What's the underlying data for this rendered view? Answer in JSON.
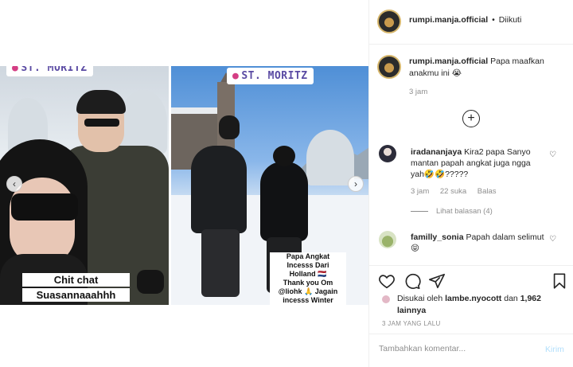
{
  "media": {
    "left_location": "ST. MORITZ",
    "right_location": "ST. MORITZ",
    "left_caption": [
      "Chit chat",
      "Suasannaaahhh"
    ],
    "right_caption": [
      "Papa Angkat",
      "Incesss Dari",
      "Holland 🇳🇱",
      "Thank you Om",
      "@liohk 🙏 Jagain",
      "incesss Winter Holiday"
    ],
    "prev_arrow": "‹",
    "next_arrow": "›"
  },
  "header": {
    "username": "rumpi.manja.official",
    "separator": "•",
    "follow_status": "Diikuti"
  },
  "caption": {
    "username": "rumpi.manja.official",
    "text": "Papa maafkan anakmu ini 😭",
    "time": "3 jam"
  },
  "more_comments": "+",
  "comments": [
    {
      "username": "iradananjaya",
      "text": "Kira2 papa Sanyo mantan papah angkat juga ngga yah🤣🤣?????",
      "time": "3 jam",
      "likes": "22 suka",
      "reply": "Balas",
      "view_replies": "Lihat balasan (4)"
    },
    {
      "username": "familly_sonia",
      "text": "Papah dalam selimut 😝"
    }
  ],
  "liked_by": {
    "prefix": "Disukai oleh",
    "user": "lambe.nyocott",
    "middle": "dan",
    "count": "1,962 lainnya"
  },
  "post_date": "3 JAM YANG LALU",
  "comment_box": {
    "placeholder": "Tambahkan komentar...",
    "post_label": "Kirim"
  },
  "icons": {
    "heart": "heart-icon",
    "comment": "comment-icon",
    "share": "share-icon",
    "save": "bookmark-icon"
  }
}
